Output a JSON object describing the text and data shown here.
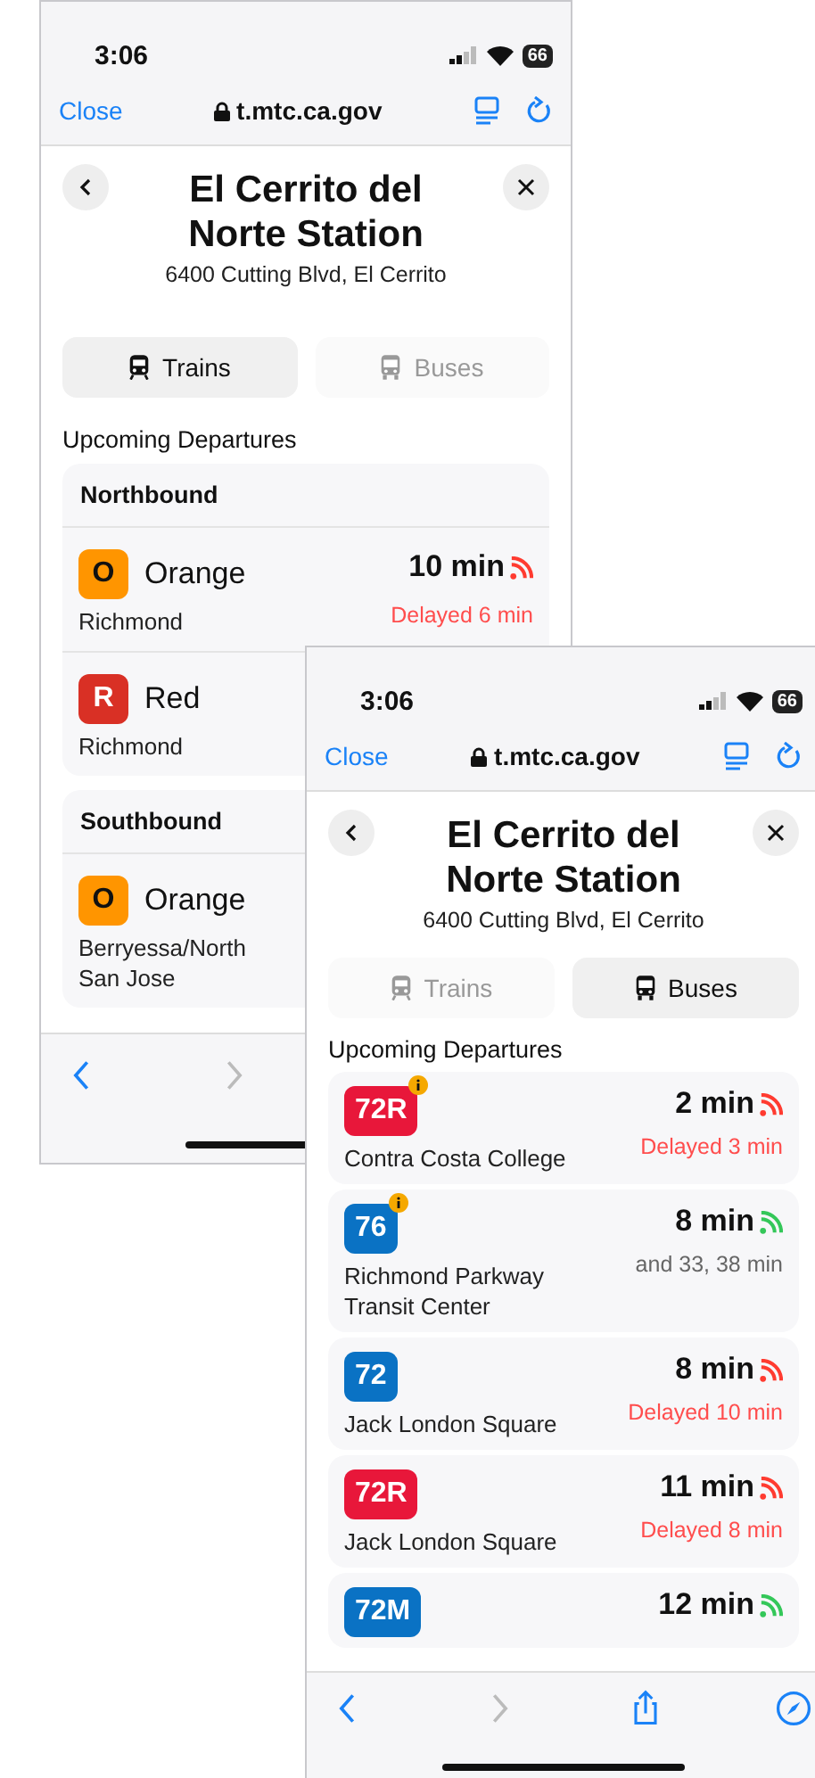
{
  "screens": [
    {
      "status_bar": {
        "time": "3:06",
        "battery": "66"
      },
      "browser_bar": {
        "close": "Close",
        "url": "t.mtc.ca.gov"
      },
      "station": {
        "name": "El Cerrito del Norte Station",
        "address": "6400 Cutting Blvd, El Cerrito"
      },
      "tabs": [
        {
          "label": "Trains",
          "kind": "train",
          "selected": true
        },
        {
          "label": "Buses",
          "kind": "bus",
          "selected": false
        }
      ],
      "section_title": "Upcoming Departures",
      "groups": [
        {
          "title": "Northbound",
          "departures": [
            {
              "route": "O",
              "color": "#ff9500",
              "line": "Orange",
              "destination": "Richmond",
              "time": "10 min",
              "note": "Delayed 6 min",
              "delayed": true,
              "info": false
            },
            {
              "route": "R",
              "color": "#d93025",
              "line": "Red",
              "destination": "Richmond",
              "info": false
            }
          ]
        },
        {
          "title": "Southbound",
          "departures": [
            {
              "route": "O",
              "color": "#ff9500",
              "line": "Orange",
              "destination": "Berryessa/North San Jose",
              "info": false
            }
          ]
        }
      ],
      "toolbar": [
        {
          "kind": "back",
          "disabled": false
        },
        {
          "kind": "forward",
          "disabled": true
        }
      ]
    },
    {
      "status_bar": {
        "time": "3:06",
        "battery": "66"
      },
      "browser_bar": {
        "close": "Close",
        "url": "t.mtc.ca.gov"
      },
      "station": {
        "name": "El Cerrito del Norte Station",
        "address": "6400 Cutting Blvd, El Cerrito"
      },
      "tabs": [
        {
          "label": "Trains",
          "kind": "train",
          "selected": false
        },
        {
          "label": "Buses",
          "kind": "bus",
          "selected": true
        }
      ],
      "section_title": "Upcoming Departures",
      "departures": [
        {
          "route": "72R",
          "color": "#e8173a",
          "destination": "Contra Costa College",
          "time": "2 min",
          "note": "Delayed 3 min",
          "delayed": true,
          "info": true
        },
        {
          "route": "76",
          "color": "#0a72c4",
          "destination": "Richmond Parkway Transit Center",
          "time": "8 min",
          "note": "and 33, 38 min",
          "delayed": false,
          "info": true
        },
        {
          "route": "72",
          "color": "#0a72c4",
          "destination": "Jack London Square",
          "time": "8 min",
          "note": "Delayed 10 min",
          "delayed": true,
          "info": false
        },
        {
          "route": "72R",
          "color": "#e8173a",
          "destination": "Jack London Square",
          "time": "11 min",
          "note": "Delayed 8 min",
          "delayed": true,
          "info": false
        },
        {
          "route": "72M",
          "color": "#0a72c4",
          "time": "12 min",
          "delayed": false,
          "info": false
        }
      ],
      "toolbar": [
        {
          "kind": "back",
          "disabled": false
        },
        {
          "kind": "forward",
          "disabled": true
        },
        {
          "kind": "share",
          "disabled": false
        },
        {
          "kind": "compass",
          "disabled": false
        }
      ]
    }
  ]
}
